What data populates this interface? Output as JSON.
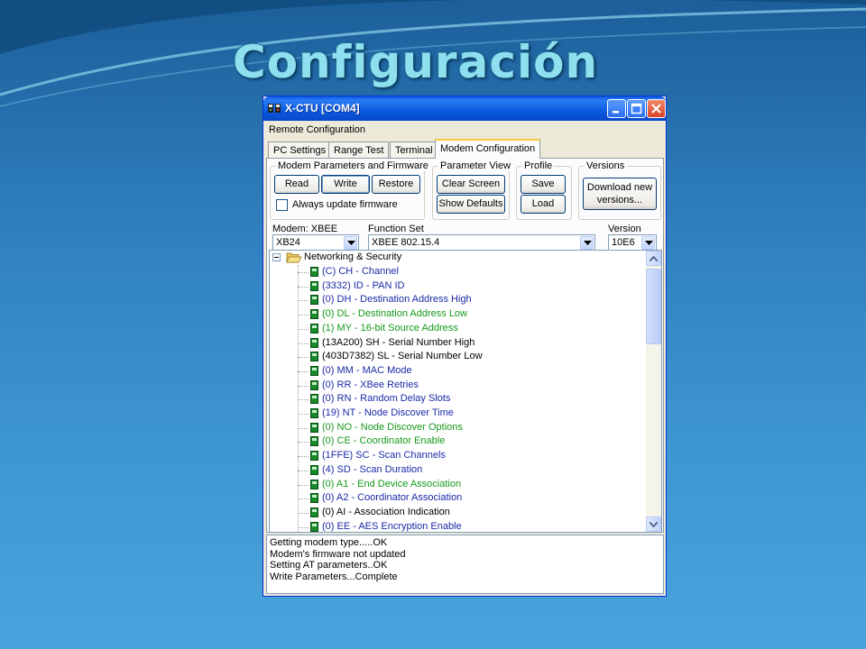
{
  "slide": {
    "title": "Configuración"
  },
  "window": {
    "title": "X-CTU  [COM4]",
    "label": "Remote Configuration"
  },
  "tabs": [
    {
      "label": "PC Settings"
    },
    {
      "label": "Range Test"
    },
    {
      "label": "Terminal"
    },
    {
      "label": "Modem Configuration",
      "active": true
    }
  ],
  "groups": {
    "modem": {
      "label": "Modem Parameters and Firmware",
      "read": "Read",
      "write": "Write",
      "restore": "Restore",
      "always_update": "Always update firmware",
      "always_update_checked": false
    },
    "param_view": {
      "label": "Parameter View",
      "clear": "Clear Screen",
      "defaults": "Show Defaults"
    },
    "profile": {
      "label": "Profile",
      "save": "Save",
      "load": "Load"
    },
    "versions": {
      "label": "Versions",
      "download": "Download new versions..."
    }
  },
  "selectors": {
    "modem": {
      "label": "Modem: XBEE",
      "value": "XB24"
    },
    "function_set": {
      "label": "Function Set",
      "value": "XBEE 802.15.4"
    },
    "version": {
      "label": "Version",
      "value": "10E6"
    }
  },
  "tree": {
    "root": "Networking & Security",
    "items": [
      {
        "text": "(C) CH - Channel",
        "color": "#1a2aa8"
      },
      {
        "text": "(3332) ID - PAN ID",
        "color": "#1a2aa8"
      },
      {
        "text": "(0) DH - Destination Address High",
        "color": "#1a2aa8"
      },
      {
        "text": "(0) DL - Destination Address Low",
        "color": "#159a1a"
      },
      {
        "text": "(1) MY - 16-bit Source Address",
        "color": "#159a1a"
      },
      {
        "text": "(13A200) SH - Serial Number High",
        "color": "#000000"
      },
      {
        "text": "(403D7382) SL - Serial Number Low",
        "color": "#000000"
      },
      {
        "text": "(0) MM - MAC Mode",
        "color": "#1a2aa8"
      },
      {
        "text": "(0) RR - XBee Retries",
        "color": "#1a2aa8"
      },
      {
        "text": "(0) RN - Random Delay Slots",
        "color": "#1a2aa8"
      },
      {
        "text": "(19) NT - Node Discover Time",
        "color": "#1a2aa8"
      },
      {
        "text": "(0) NO - Node Discover Options",
        "color": "#159a1a"
      },
      {
        "text": "(0) CE - Coordinator Enable",
        "color": "#159a1a"
      },
      {
        "text": "(1FFE) SC - Scan Channels",
        "color": "#1a2aa8"
      },
      {
        "text": "(4) SD - Scan Duration",
        "color": "#1a2aa8"
      },
      {
        "text": "(0) A1 - End Device Association",
        "color": "#159a1a"
      },
      {
        "text": "(0) A2 - Coordinator Association",
        "color": "#1a2aa8"
      },
      {
        "text": "(0) AI - Association Indication",
        "color": "#000000"
      },
      {
        "text": "(0) EE - AES Encryption Enable",
        "color": "#1a2aa8"
      }
    ]
  },
  "log": [
    "Getting modem type.....OK",
    "Modem's firmware not updated",
    "Setting AT parameters..OK",
    "Write Parameters...Complete"
  ],
  "colors": {
    "titlebar": "#0a58e2",
    "node_icon": "#178a2a"
  }
}
